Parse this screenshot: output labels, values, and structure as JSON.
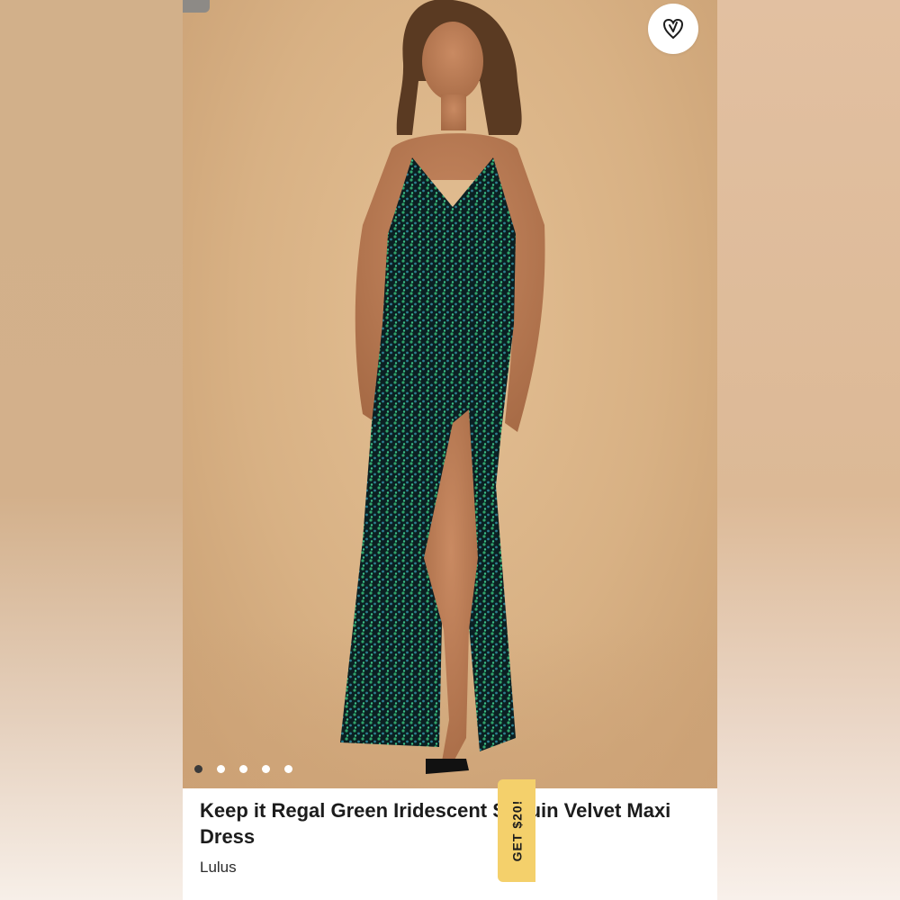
{
  "product": {
    "title": "Keep it Regal Green Iridescent Sequin Velvet Maxi Dress",
    "brand": "Lulus"
  },
  "gallery": {
    "image_alt_icon": "model-photo",
    "dots_count": 5,
    "active_index": 0
  },
  "actions": {
    "favorite_icon": "heart-icon"
  },
  "promo": {
    "label": "GET $20!"
  },
  "colors": {
    "promo_bg": "#f4d06b",
    "dress": "#0d2a2a",
    "sequin_green": "#2fa36b",
    "sequin_teal": "#2b7f8f"
  }
}
